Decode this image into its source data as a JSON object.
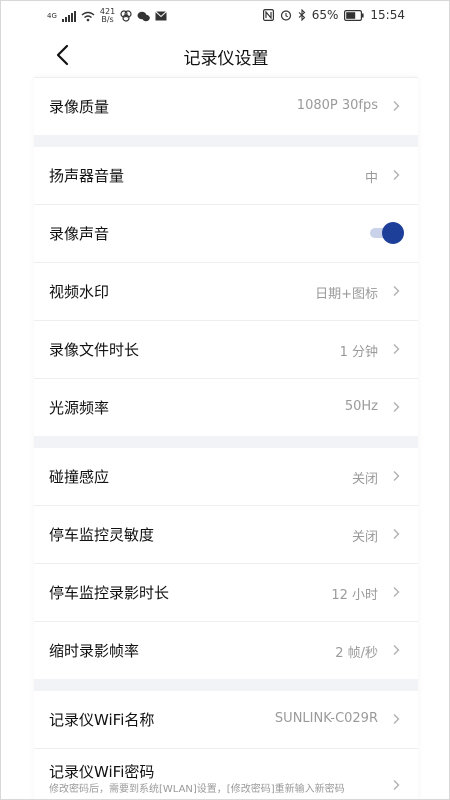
{
  "status": {
    "network_label": "4G",
    "speed_value": "421",
    "speed_unit": "B/s",
    "battery": "65%",
    "time": "15:54"
  },
  "header": {
    "title": "记录仪设置"
  },
  "sections": [
    {
      "rows": [
        {
          "label": "录像质量",
          "value": "1080P 30fps"
        }
      ]
    },
    {
      "rows": [
        {
          "label": "扬声器音量",
          "value": "中"
        },
        {
          "label": "录像声音",
          "toggle": true
        },
        {
          "label": "视频水印",
          "value": "日期+图标"
        },
        {
          "label": "录像文件时长",
          "value": "1 分钟"
        },
        {
          "label": "光源频率",
          "value": "50Hz"
        }
      ]
    },
    {
      "rows": [
        {
          "label": "碰撞感应",
          "value": "关闭"
        },
        {
          "label": "停车监控灵敏度",
          "value": "关闭"
        },
        {
          "label": "停车监控录影时长",
          "value": "12 小时"
        },
        {
          "label": "缩时录影帧率",
          "value": "2 帧/秒"
        }
      ]
    },
    {
      "rows": [
        {
          "label": "记录仪WiFi名称",
          "value": "SUNLINK-C029R"
        },
        {
          "label": "记录仪WiFi密码",
          "sub": "修改密码后，需要到系统[WLAN]设置，[修改密码]重新输入新密码"
        }
      ]
    }
  ],
  "colors": {
    "accent": "#1e3f99",
    "section_gap": "#f1f3f7",
    "value_text": "#9a9a9a"
  }
}
